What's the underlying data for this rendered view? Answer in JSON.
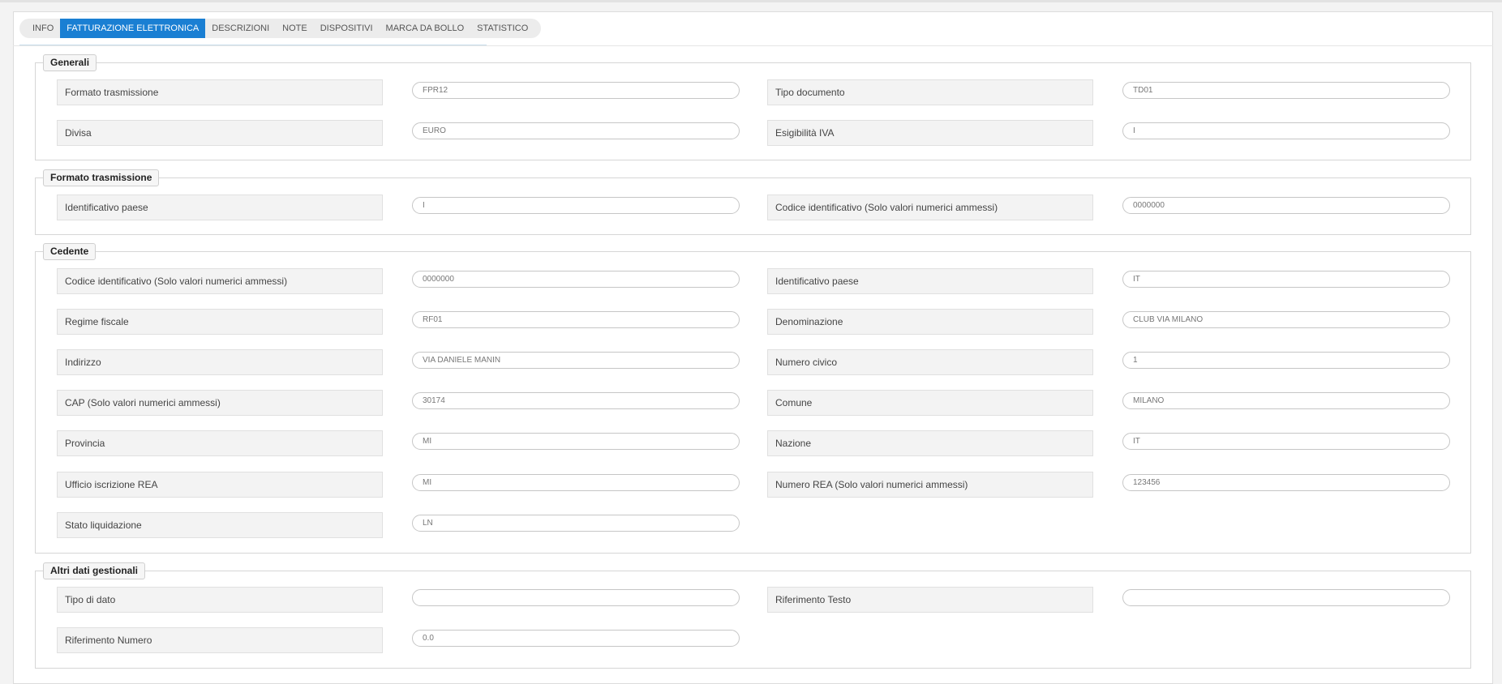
{
  "tabs": [
    {
      "label": "INFO"
    },
    {
      "label": "FATTURAZIONE ELETTRONICA"
    },
    {
      "label": "DESCRIZIONI"
    },
    {
      "label": "NOTE"
    },
    {
      "label": "DISPOSITIVI"
    },
    {
      "label": "MARCA DA BOLLO"
    },
    {
      "label": "STATISTICO"
    }
  ],
  "active_tab_color": "#1a7fd3",
  "sections": {
    "generali": {
      "title": "Generali",
      "formato_trasmissione": {
        "label": "Formato trasmissione",
        "value": "FPR12"
      },
      "tipo_documento": {
        "label": "Tipo documento",
        "value": "TD01"
      },
      "divisa": {
        "label": "Divisa",
        "value": "EURO"
      },
      "esigibilita_iva": {
        "label": "Esigibilità IVA",
        "value": "I"
      }
    },
    "formato_trasmissione": {
      "title": "Formato trasmissione",
      "identificativo_paese": {
        "label": "Identificativo paese",
        "value": "I"
      },
      "codice_identificativo": {
        "label": "Codice identificativo (Solo valori numerici ammessi)",
        "value": "0000000"
      }
    },
    "cedente": {
      "title": "Cedente",
      "codice_identificativo": {
        "label": "Codice identificativo (Solo valori numerici ammessi)",
        "value": "0000000"
      },
      "identificativo_paese": {
        "label": "Identificativo paese",
        "value": "IT"
      },
      "regime_fiscale": {
        "label": "Regime fiscale",
        "value": "RF01"
      },
      "denominazione": {
        "label": "Denominazione",
        "value": "CLUB VIA MILANO"
      },
      "indirizzo": {
        "label": "Indirizzo",
        "value": "VIA DANIELE MANIN"
      },
      "numero_civico": {
        "label": "Numero civico",
        "value": "1"
      },
      "cap": {
        "label": "CAP (Solo valori numerici ammessi)",
        "value": "30174"
      },
      "comune": {
        "label": "Comune",
        "value": "MILANO"
      },
      "provincia": {
        "label": "Provincia",
        "value": "MI"
      },
      "nazione": {
        "label": "Nazione",
        "value": "IT"
      },
      "ufficio_rea": {
        "label": "Ufficio iscrizione REA",
        "value": "MI"
      },
      "numero_rea": {
        "label": "Numero REA (Solo valori numerici ammessi)",
        "value": "123456"
      },
      "stato_liquidazione": {
        "label": "Stato liquidazione",
        "value": "LN"
      }
    },
    "altri_dati": {
      "title": "Altri dati gestionali",
      "tipo_di_dato": {
        "label": "Tipo di dato",
        "value": ""
      },
      "riferimento_testo": {
        "label": "Riferimento Testo",
        "value": ""
      },
      "riferimento_numero": {
        "label": "Riferimento Numero",
        "value": "0.0"
      }
    }
  }
}
